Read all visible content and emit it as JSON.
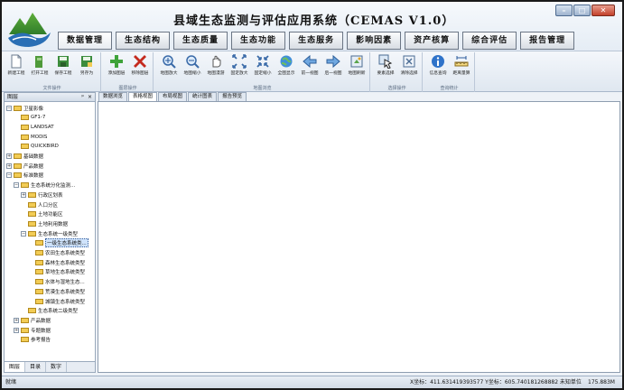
{
  "app": {
    "title": "县域生态监测与评估应用系统（CEMAS V1.0）"
  },
  "window": {
    "minimize": "–",
    "maximize": "□",
    "close": "✕"
  },
  "menu": [
    "数据管理",
    "生态结构",
    "生态质量",
    "生态功能",
    "生态服务",
    "影响因素",
    "资产核算",
    "综合评估",
    "报告管理"
  ],
  "ribbon": {
    "groups": [
      {
        "label": "文件操作",
        "tools": [
          {
            "label": "新建工程",
            "icon": "new-project-icon"
          },
          {
            "label": "打开工程",
            "icon": "open-project-icon"
          },
          {
            "label": "保存工程",
            "icon": "save-project-icon"
          },
          {
            "label": "另存为",
            "icon": "save-as-icon"
          }
        ]
      },
      {
        "label": "图层操作",
        "tools": [
          {
            "label": "添加图层",
            "icon": "add-layer-icon"
          },
          {
            "label": "移除图层",
            "icon": "remove-layer-icon"
          }
        ]
      },
      {
        "label": "地图浏览",
        "tools": [
          {
            "label": "地图放大",
            "icon": "zoom-in-icon"
          },
          {
            "label": "地图缩小",
            "icon": "zoom-out-icon"
          },
          {
            "label": "地图漫游",
            "icon": "pan-icon"
          },
          {
            "label": "固定放大",
            "icon": "fixed-zoom-in-icon"
          },
          {
            "label": "固定缩小",
            "icon": "fixed-zoom-out-icon"
          },
          {
            "label": "全图显示",
            "icon": "full-extent-icon"
          },
          {
            "label": "前一视图",
            "icon": "prev-view-icon"
          },
          {
            "label": "后一视图",
            "icon": "next-view-icon"
          },
          {
            "label": "地图刷新",
            "icon": "refresh-icon"
          }
        ]
      },
      {
        "label": "选择操作",
        "tools": [
          {
            "label": "要素选择",
            "icon": "select-feature-icon"
          },
          {
            "label": "清除选择",
            "icon": "clear-selection-icon"
          }
        ]
      },
      {
        "label": "查询统计",
        "tools": [
          {
            "label": "信息查询",
            "icon": "info-icon"
          },
          {
            "label": "距离量算",
            "icon": "measure-icon"
          }
        ]
      }
    ]
  },
  "left_panel": {
    "title": "图层",
    "pin": "ᵖ",
    "close": "×",
    "tree": [
      {
        "label": "卫星影像",
        "depth": 0,
        "exp": "−"
      },
      {
        "label": "GF1-7",
        "depth": 1,
        "exp": ""
      },
      {
        "label": "LANDSAT",
        "depth": 1,
        "exp": ""
      },
      {
        "label": "MODIS",
        "depth": 1,
        "exp": ""
      },
      {
        "label": "QUICKBIRD",
        "depth": 1,
        "exp": ""
      },
      {
        "label": "基础数据",
        "depth": 0,
        "exp": "+"
      },
      {
        "label": "产品数据",
        "depth": 0,
        "exp": "+"
      },
      {
        "label": "标准数据",
        "depth": 0,
        "exp": "−"
      },
      {
        "label": "生态系统分化监测...",
        "depth": 1,
        "exp": "−"
      },
      {
        "label": "行政区划表",
        "depth": 2,
        "exp": "+"
      },
      {
        "label": "人口分区",
        "depth": 2,
        "exp": ""
      },
      {
        "label": "土地功能区",
        "depth": 2,
        "exp": ""
      },
      {
        "label": "土地利用数据",
        "depth": 2,
        "exp": ""
      },
      {
        "label": "生态系统一级类型",
        "depth": 2,
        "exp": "−"
      },
      {
        "label": "一级生态系统类...",
        "depth": 3,
        "exp": "",
        "selected": true
      },
      {
        "label": "农田生态系统类型",
        "depth": 3,
        "exp": ""
      },
      {
        "label": "森林生态系统类型",
        "depth": 3,
        "exp": ""
      },
      {
        "label": "草地生态系统类型",
        "depth": 3,
        "exp": ""
      },
      {
        "label": "水体与湿地生态...",
        "depth": 3,
        "exp": ""
      },
      {
        "label": "荒漠生态系统类型",
        "depth": 3,
        "exp": ""
      },
      {
        "label": "城镇生态系统类型",
        "depth": 3,
        "exp": ""
      },
      {
        "label": "生态系统二级类型",
        "depth": 2,
        "exp": ""
      },
      {
        "label": "产品数据",
        "depth": 1,
        "exp": "+"
      },
      {
        "label": "专题数据",
        "depth": 1,
        "exp": "+"
      },
      {
        "label": "参考报告",
        "depth": 1,
        "exp": ""
      }
    ],
    "tabs": [
      "图层",
      "目录",
      "数字"
    ]
  },
  "doc_tabs": [
    "数据浏览",
    "表格视图",
    "布局视图",
    "统计图表",
    "报告预览"
  ],
  "status": {
    "left": "就绪",
    "coords": "X坐标：411.631419393577  Y坐标：605.740181268882  未知单位",
    "memory": "175.883M"
  },
  "colors": {
    "accent": "#2a6fb5",
    "menu_border": "#6b7685",
    "doc_bg": "#ffffff"
  }
}
